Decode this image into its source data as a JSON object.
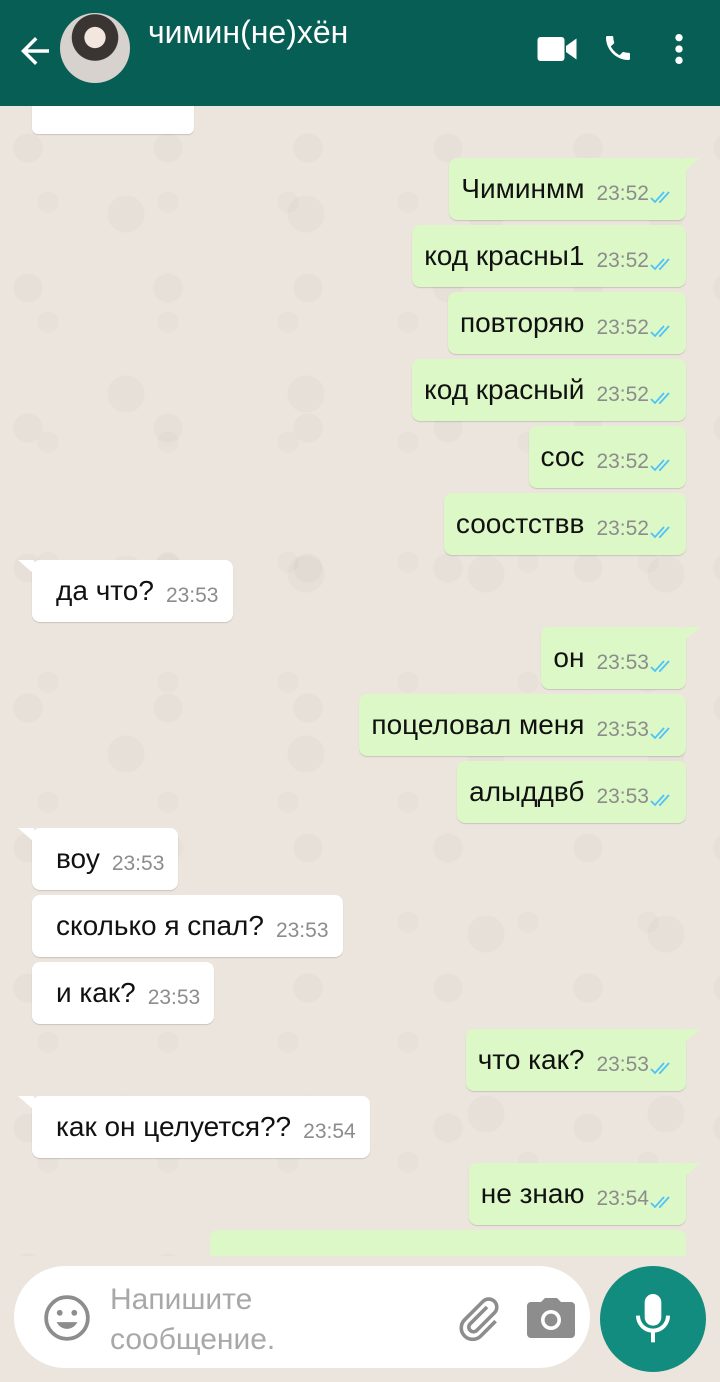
{
  "header": {
    "contact_name": "чимин(не)хён",
    "icons": [
      "back-arrow-icon",
      "video-call-icon",
      "phone-icon",
      "more-vert-icon"
    ]
  },
  "messages": [
    {
      "dir": "out",
      "text": "Чиминмм",
      "time": "23:52",
      "ticks": "read"
    },
    {
      "dir": "out",
      "text": "код красны1",
      "time": "23:52",
      "ticks": "read"
    },
    {
      "dir": "out",
      "text": "повторяю",
      "time": "23:52",
      "ticks": "read"
    },
    {
      "dir": "out",
      "text": "код красный",
      "time": "23:52",
      "ticks": "read"
    },
    {
      "dir": "out",
      "text": "сос",
      "time": "23:52",
      "ticks": "read"
    },
    {
      "dir": "out",
      "text": "соостствв",
      "time": "23:52",
      "ticks": "read"
    },
    {
      "dir": "in",
      "text": "да что?",
      "time": "23:53"
    },
    {
      "dir": "out",
      "text": "он",
      "time": "23:53",
      "ticks": "read"
    },
    {
      "dir": "out",
      "text": "поцеловал меня",
      "time": "23:53",
      "ticks": "read"
    },
    {
      "dir": "out",
      "text": "алыддвб",
      "time": "23:53",
      "ticks": "read"
    },
    {
      "dir": "in",
      "text": "воу",
      "time": "23:53"
    },
    {
      "dir": "in",
      "text": "сколько я спал?",
      "time": "23:53"
    },
    {
      "dir": "in",
      "text": "и как?",
      "time": "23:53"
    },
    {
      "dir": "out",
      "text": "что как?",
      "time": "23:53",
      "ticks": "read"
    },
    {
      "dir": "in",
      "text": "как он целуется??",
      "time": "23:54"
    },
    {
      "dir": "out",
      "text": "не знаю",
      "time": "23:54",
      "ticks": "read"
    }
  ],
  "composer": {
    "placeholder": "Напишите сообщение.",
    "icons": [
      "emoji-icon",
      "attach-icon",
      "camera-icon",
      "mic-icon"
    ]
  },
  "colors": {
    "header": "#075e54",
    "outgoing_bubble": "#dcf8c6",
    "incoming_bubble": "#ffffff",
    "read_ticks": "#4fc3f7",
    "mic_button": "#128c7e"
  }
}
